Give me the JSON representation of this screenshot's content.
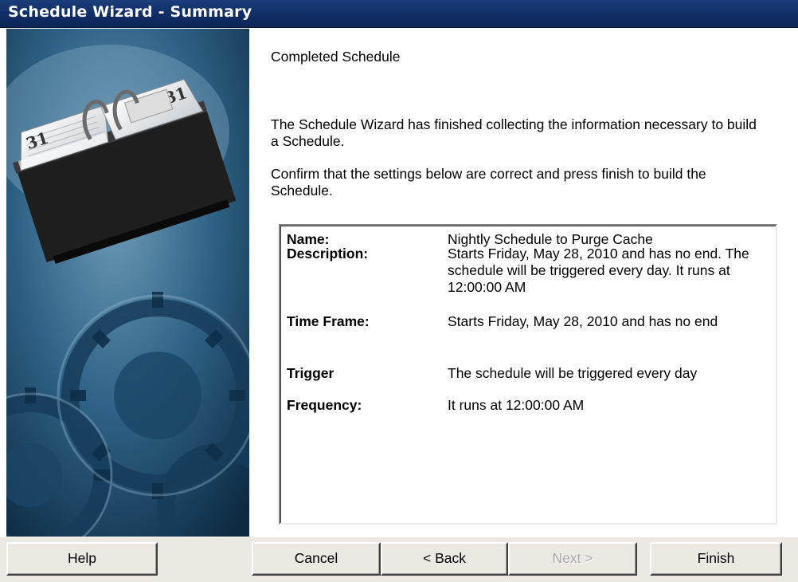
{
  "window": {
    "title": "Schedule Wizard - Summary"
  },
  "page": {
    "heading": "Completed Schedule",
    "intro": "The Schedule Wizard has finished collecting the information necessary to build a Schedule.",
    "confirm": "Confirm that the settings below are correct and press finish to build the Schedule."
  },
  "summary": {
    "name_label": "Name:",
    "name_value": "Nightly Schedule to Purge Cache",
    "description_label": "Description:",
    "description_value": "Starts Friday, May 28, 2010 and has no end. The schedule will be triggered every day. It runs at 12:00:00 AM",
    "timeframe_label": "Time Frame:",
    "timeframe_value": "Starts Friday, May 28, 2010 and has no end",
    "trigger_label": "Trigger",
    "trigger_value": "The schedule will be triggered every day",
    "frequency_label": "Frequency:",
    "frequency_value": "It runs at 12:00:00 AM"
  },
  "buttons": {
    "help": "Help",
    "cancel": "Cancel",
    "back": "< Back",
    "next": "Next >",
    "finish": "Finish"
  },
  "colors": {
    "title_bar": "#0f2c63",
    "button_face": "#ece9e3",
    "side_image_base": "#2b5a7c"
  },
  "icons": {
    "side_image": "calendar-and-gears-illustration"
  }
}
